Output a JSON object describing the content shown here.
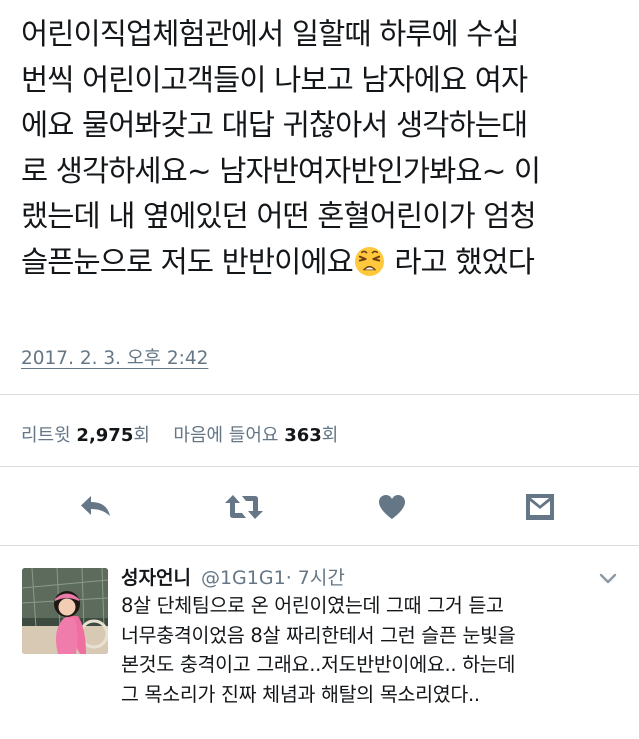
{
  "tweet": {
    "text_lines": [
      "어린이직업체험관에서 일할때 하루에 수십",
      "번씩 어린이고객들이 나보고 남자에요 여자",
      "에요 물어봐갖고 대답 귀찮아서 생각하는대",
      "로 생각하세요~ 남자반여자반인가봐요~ 이",
      "랬는데 내 옆에있던 어떤 혼혈어린이가 엄청"
    ],
    "last_line_before_emoji": "슬픈눈으로 저도 반반이에요",
    "emoji_icon": "weary-face-emoji",
    "last_line_after_emoji": " 라고 했었다",
    "timestamp": "2017. 2. 3. 오후 2:42"
  },
  "stats": {
    "retweet_label": "리트윗",
    "retweet_count": "2,975",
    "retweet_suffix": "회",
    "like_label": "마음에 들어요",
    "like_count": "363",
    "like_suffix": "회"
  },
  "actions": {
    "icons": [
      "reply-icon",
      "retweet-icon",
      "heart-icon",
      "message-icon"
    ],
    "icon_color": "#657786"
  },
  "reply": {
    "name": "성자언니",
    "handle": "@1G1G1",
    "time": "· 7시간",
    "text_lines": [
      "8살 단체팀으로 온 어린이였는데 그때 그거 듣고",
      "너무충격이었음 8살 짜리한테서 그런 슬픈 눈빛을",
      "본것도 충격이고 그래요..저도반반이에요.. 하는데",
      "그 목소리가 진짜 체념과 해탈의 목소리였다.."
    ]
  },
  "colors": {
    "text": "#14171a",
    "secondary": "#657786",
    "divider": "#d8dde1"
  }
}
